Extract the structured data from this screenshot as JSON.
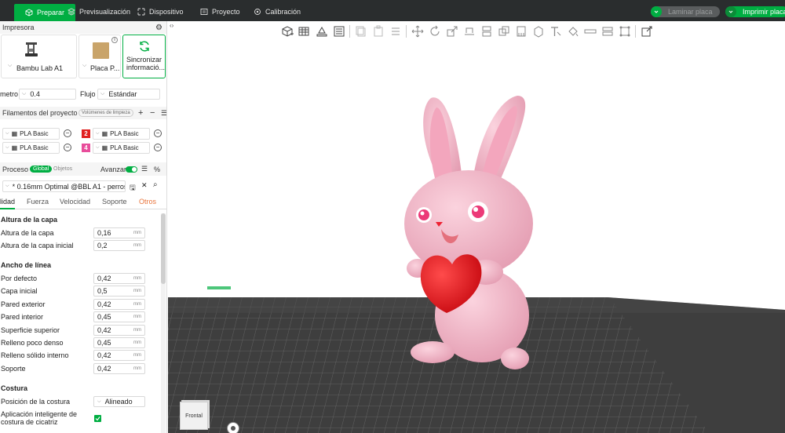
{
  "topbar": {
    "tabs": [
      {
        "label": "Preparar",
        "icon": "cube-icon"
      },
      {
        "label": "Previsualización",
        "icon": "layers-icon"
      },
      {
        "label": "Dispositivo",
        "icon": "device-icon"
      },
      {
        "label": "Proyecto",
        "icon": "project-icon"
      },
      {
        "label": "Calibración",
        "icon": "calibration-icon"
      }
    ],
    "slice_label": "Laminar placa",
    "print_label": "Imprimir placa"
  },
  "printer": {
    "section_title": "Impresora",
    "printer_name": "Bambu Lab A1",
    "plate_name": "Placa P...",
    "sync_label_1": "Sincronizar",
    "sync_label_2": "informació...",
    "nozzle_label": "metro",
    "nozzle_value": "0.4",
    "flow_label": "Flujo",
    "flow_value": "Estándar"
  },
  "filaments": {
    "section_title": "Filamentos del proyecto",
    "purge_label": "Volúmenes de limpieza",
    "items": [
      {
        "name": "PLA Basic",
        "slot": "",
        "color": "#ffffff"
      },
      {
        "name": "PLA Basic",
        "slot": "2",
        "color": "#e0201f"
      },
      {
        "name": "PLA Basic",
        "slot": "",
        "color": "#ffffff"
      },
      {
        "name": "PLA Basic",
        "slot": "4",
        "color": "#e84d9b"
      }
    ]
  },
  "process": {
    "section_title": "Proceso",
    "global_label": "Global",
    "objects_label": "Objetos",
    "advanced_label": "Avanzar",
    "profile": "* 0.16mm Optimal @BBL A1 - perros",
    "tabs": [
      "lidad",
      "Fuerza",
      "Velocidad",
      "Soporte",
      "Otros"
    ]
  },
  "params": {
    "layer_height_group": "Altura de la capa",
    "layer_height_label": "Altura de la capa",
    "layer_height_value": "0,16",
    "initial_layer_label": "Altura de la capa inicial",
    "initial_layer_value": "0,2",
    "line_width_group": "Ancho de línea",
    "widths": [
      {
        "label": "Por defecto",
        "value": "0,42"
      },
      {
        "label": "Capa inicial",
        "value": "0,5"
      },
      {
        "label": "Pared exterior",
        "value": "0,42"
      },
      {
        "label": "Pared interior",
        "value": "0,45"
      },
      {
        "label": "Superficie superior",
        "value": "0,42"
      },
      {
        "label": "Relleno poco denso",
        "value": "0,45"
      },
      {
        "label": "Relleno sólido interno",
        "value": "0,42"
      },
      {
        "label": "Soporte",
        "value": "0,42"
      }
    ],
    "unit": "mm",
    "seam_group": "Costura",
    "seam_pos_label": "Posición de la costura",
    "seam_pos_value": "Alineado",
    "smart_seam_label_1": "Aplicación inteligente de",
    "smart_seam_label_2": "costura de cicatriz"
  },
  "viewport": {
    "view_cube_label": "Frontal"
  },
  "colors": {
    "accent": "#00ae42",
    "topbar": "#2a2d2e",
    "bunny": "#f4b8c8",
    "heart": "#e8141c"
  }
}
